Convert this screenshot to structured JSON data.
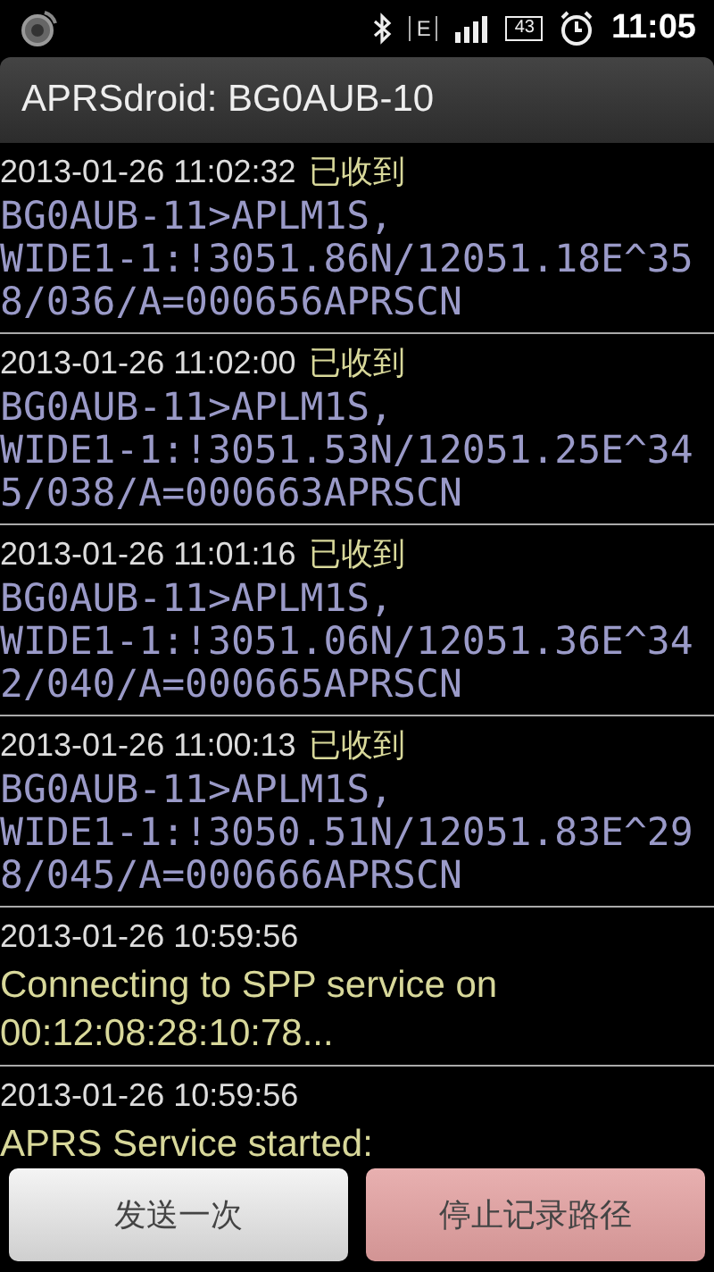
{
  "status_bar": {
    "network": "E",
    "battery": "43",
    "time": "11:05"
  },
  "title": "APRSdroid: BG0AUB-10",
  "log": [
    {
      "kind": "packet",
      "time": "2013-01-26 11:02:32",
      "status": "已收到",
      "lines": [
        "BG0AUB-11>APLM1S,",
        "WIDE1-1:!3051.86N/12051.18E^35",
        "8/036/A=000656APRSCN"
      ]
    },
    {
      "kind": "packet",
      "time": "2013-01-26 11:02:00",
      "status": "已收到",
      "lines": [
        "BG0AUB-11>APLM1S,",
        "WIDE1-1:!3051.53N/12051.25E^34",
        "5/038/A=000663APRSCN"
      ]
    },
    {
      "kind": "packet",
      "time": "2013-01-26 11:01:16",
      "status": "已收到",
      "lines": [
        "BG0AUB-11>APLM1S,",
        "WIDE1-1:!3051.06N/12051.36E^34",
        "2/040/A=000665APRSCN"
      ]
    },
    {
      "kind": "packet",
      "time": "2013-01-26 11:00:13",
      "status": "已收到",
      "lines": [
        "BG0AUB-11>APLM1S,",
        "WIDE1-1:!3050.51N/12051.83E^29",
        "8/045/A=000666APRSCN"
      ]
    },
    {
      "kind": "info",
      "time": "2013-01-26 10:59:56",
      "lines": [
        "Connecting to SPP service on",
        "00:12:08:28:10:78..."
      ]
    },
    {
      "kind": "info",
      "time": "2013-01-26 10:59:56",
      "lines": [
        "APRS Service started:"
      ]
    }
  ],
  "buttons": [
    {
      "label": "发送一次",
      "kind": "normal"
    },
    {
      "label": "停止记录路径",
      "kind": "stop"
    }
  ]
}
